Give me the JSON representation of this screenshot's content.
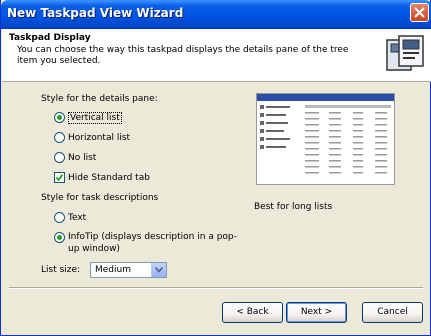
{
  "window": {
    "title": "New Taskpad View Wizard"
  },
  "header": {
    "title": "Taskpad Display",
    "description": "You can choose the way this taskpad displays the details pane of the tree item you selected."
  },
  "details_pane": {
    "label": "Style for the details pane:",
    "options": [
      "Vertical list",
      "Horizontal list",
      "No list"
    ],
    "selected": "Vertical list",
    "hide_standard_tab_label": "Hide Standard tab",
    "hide_standard_tab_checked": true
  },
  "task_descriptions": {
    "label": "Style for task descriptions",
    "options": [
      "Text",
      "InfoTip (displays description in a pop-up window)"
    ],
    "selected": "InfoTip (displays description in a pop-up window)"
  },
  "list_size": {
    "label": "List size:",
    "value": "Medium"
  },
  "preview": {
    "caption": "Best for long lists"
  },
  "buttons": {
    "back": "< Back",
    "next": "Next >",
    "cancel": "Cancel"
  },
  "colors": {
    "titlebar": "#0054e3",
    "dialog": "#ece9d8",
    "selected_radio": "#21a121"
  },
  "icons": [
    "close-icon",
    "wizard-icon",
    "chevron-down-icon",
    "checkmark-icon"
  ]
}
